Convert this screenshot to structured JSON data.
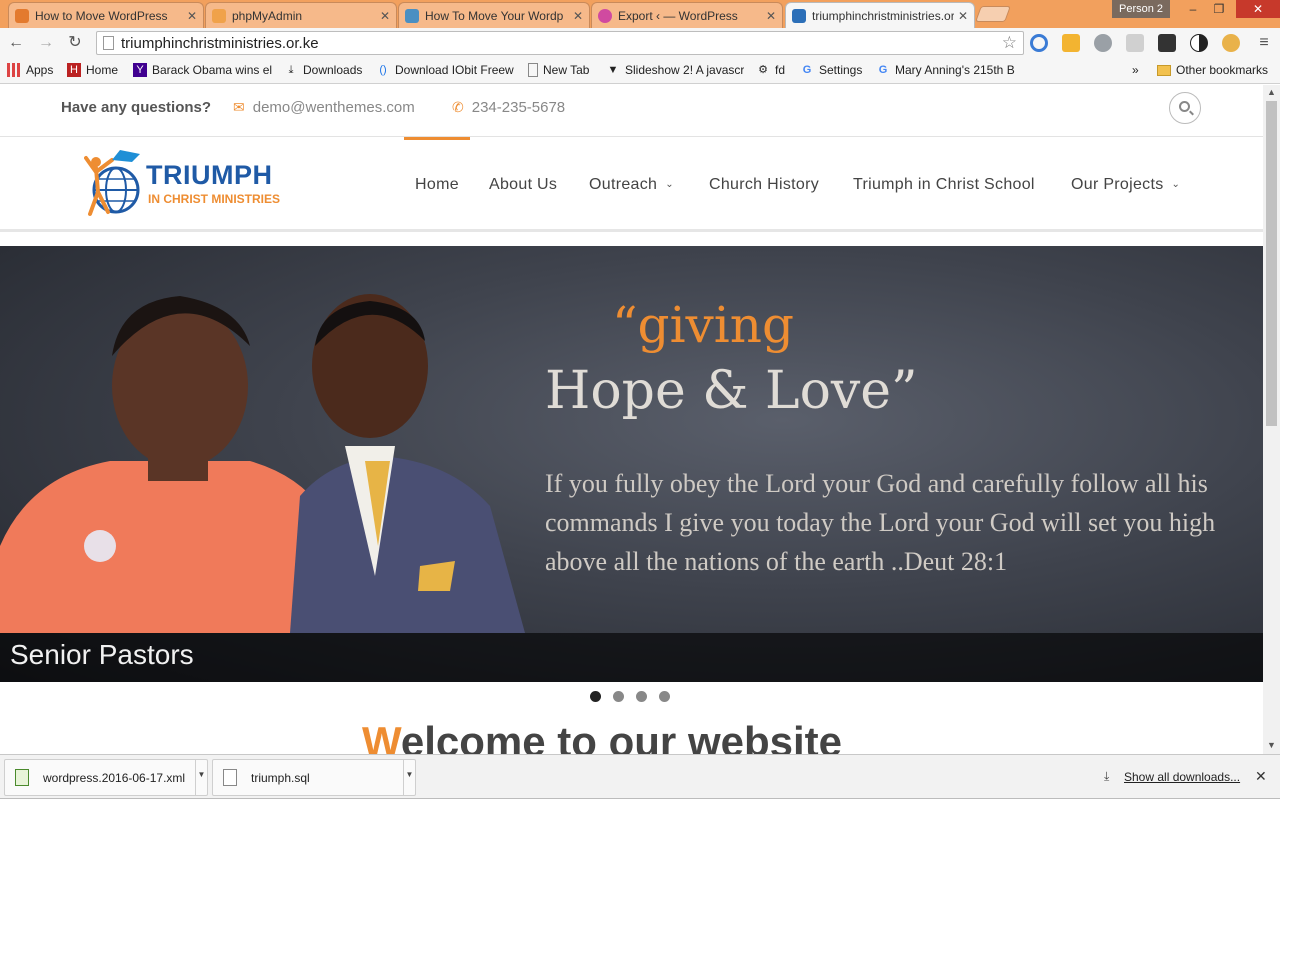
{
  "browser": {
    "tabs": [
      {
        "title": "How to Move WordPress",
        "favicon_color": "#e37a2e"
      },
      {
        "title": "phpMyAdmin",
        "favicon_color": "#f0a24a"
      },
      {
        "title": "How To Move Your Wordp",
        "favicon_color": "#4a8fc2"
      },
      {
        "title": "Export ‹ — WordPress",
        "favicon_color": "#d04aa0"
      },
      {
        "title": "triumphinchristministries.or",
        "favicon_color": "#2c6fb8"
      }
    ],
    "profile_label": "Person 2",
    "url": "triumphinchristministries.or.ke",
    "bookmarks": [
      {
        "label": "Apps",
        "icon": "apps-grid-icon"
      },
      {
        "label": "Home",
        "icon": "home-icon"
      },
      {
        "label": "Barack Obama wins el",
        "icon": "yahoo-icon"
      },
      {
        "label": "Downloads",
        "icon": "download-icon"
      },
      {
        "label": "Download IObit Freew",
        "icon": "iobit-icon"
      },
      {
        "label": "New Tab",
        "icon": "page-icon"
      },
      {
        "label": "Slideshow 2! A javascr",
        "icon": "funnel-icon"
      },
      {
        "label": "fd",
        "icon": "gear-icon"
      },
      {
        "label": "Settings",
        "icon": "google-icon"
      },
      {
        "label": "Mary Anning's 215th B",
        "icon": "google-icon"
      }
    ],
    "bookmarks_overflow": "»",
    "other_bookmarks": "Other bookmarks"
  },
  "site": {
    "topbar": {
      "question": "Have any questions?",
      "email": "demo@wenthemes.com",
      "phone": "234-235-5678"
    },
    "logo": {
      "line1": "TRIUMPH",
      "line2": "IN CHRIST MINISTRIES"
    },
    "nav": [
      {
        "label": "Home",
        "active": true,
        "dropdown": false
      },
      {
        "label": "About Us",
        "active": false,
        "dropdown": false
      },
      {
        "label": "Outreach",
        "active": false,
        "dropdown": true
      },
      {
        "label": "Church History",
        "active": false,
        "dropdown": false
      },
      {
        "label": "Triumph in Christ School",
        "active": false,
        "dropdown": false
      },
      {
        "label": "Our Projects",
        "active": false,
        "dropdown": true
      }
    ],
    "hero": {
      "quote_line1": "“giving",
      "quote_line2": "Hope & Love”",
      "verse": "If you fully obey the Lord your God and carefully follow all his commands I give you today the Lord your God will set you high above all the nations of the earth ..Deut 28:1",
      "caption": "Senior Pastors",
      "slides_total": 4,
      "active_slide": 1
    },
    "welcome": {
      "first_letter": "W",
      "rest": "elcome to our website"
    }
  },
  "downloads": {
    "items": [
      {
        "filename": "wordpress.2016-06-17.xml"
      },
      {
        "filename": "triumph.sql"
      }
    ],
    "show_all": "Show all downloads..."
  },
  "colors": {
    "accent": "#ee8d32",
    "brand_blue": "#1f5aa6",
    "tabstrip": "#f2a05d"
  }
}
